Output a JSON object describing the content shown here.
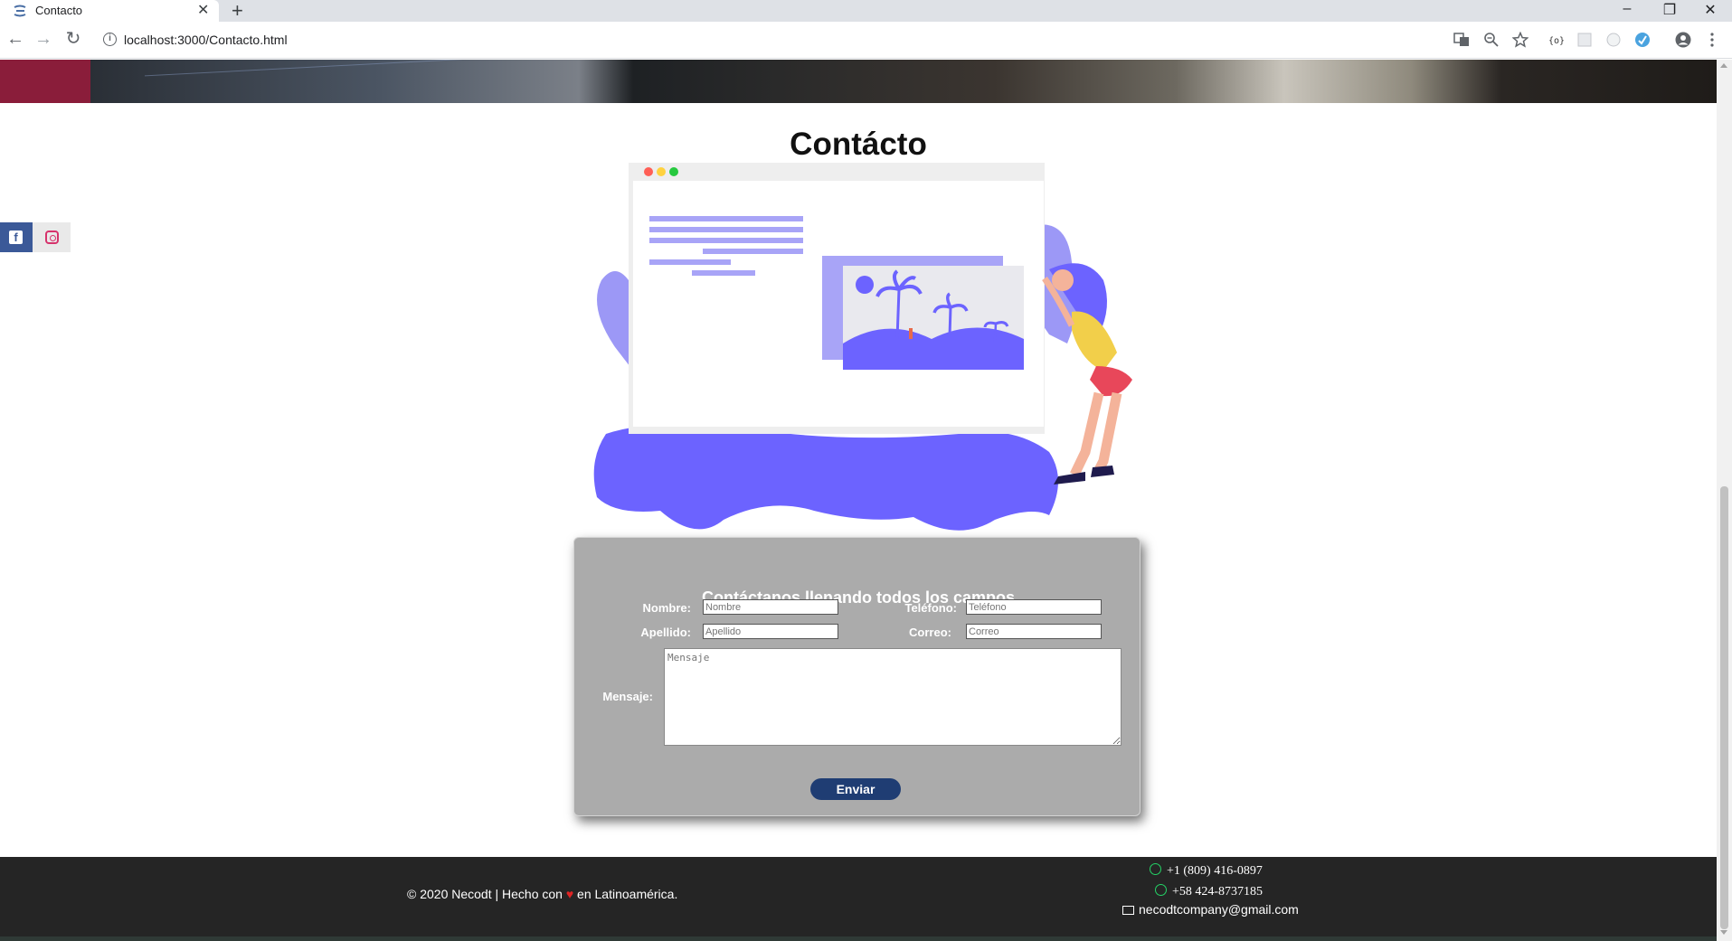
{
  "browser": {
    "tab_title": "Contacto",
    "tab_close": "✕",
    "new_tab": "+",
    "url": "localhost:3000/Contacto.html",
    "info_icon": "i",
    "win_minimize": "–",
    "win_restore": "❐",
    "win_close": "✕",
    "back": "←",
    "forward": "→",
    "reload": "↻"
  },
  "social": {
    "facebook_glyph": "f"
  },
  "page": {
    "title": "Contácto"
  },
  "form": {
    "heading": "Contáctanos llenando todos los campos",
    "nombre_label": "Nombre:",
    "nombre_placeholder": "Nombre",
    "apellido_label": "Apellido:",
    "apellido_placeholder": "Apellido",
    "telefono_label": "Teléfono:",
    "telefono_placeholder": "Teléfono",
    "correo_label": "Correo:",
    "correo_placeholder": "Correo",
    "mensaje_label": "Mensaje:",
    "mensaje_placeholder": "Mensaje",
    "submit_label": "Enviar"
  },
  "footer": {
    "copyright_prefix": "© 2020 Necodt | Hecho con",
    "heart": "♥",
    "copyright_suffix": "en Latinoamérica.",
    "phone_1": "+1 (809) 416-0897",
    "phone_2": "+58 424-8737185",
    "email": "necodtcompany@gmail.com"
  },
  "colors": {
    "form_bg": "#ababab",
    "button_bg": "#1f3d73",
    "footer_bg": "#252525",
    "illustration_accent": "#6c63ff",
    "facebook": "#3b5998",
    "whatsapp": "#25d366"
  }
}
